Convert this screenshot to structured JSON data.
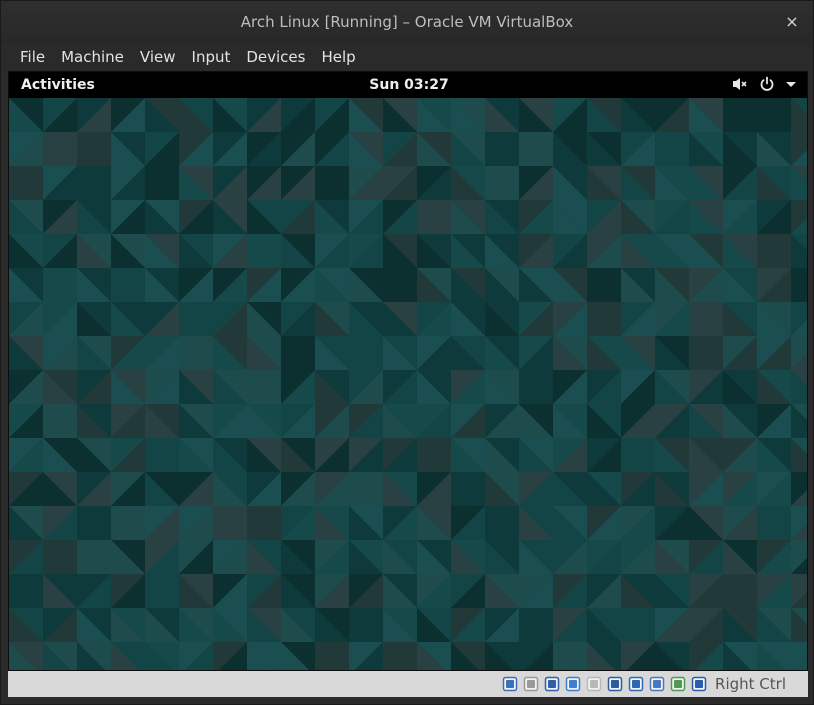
{
  "window": {
    "title": "Arch Linux [Running] – Oracle VM VirtualBox",
    "close_glyph": "×"
  },
  "menubar": {
    "items": [
      {
        "label": "File"
      },
      {
        "label": "Machine"
      },
      {
        "label": "View"
      },
      {
        "label": "Input"
      },
      {
        "label": "Devices"
      },
      {
        "label": "Help"
      }
    ]
  },
  "guest": {
    "topbar": {
      "activities_label": "Activities",
      "clock": "Sun 03:27",
      "status_icons": [
        "volume-muted-icon",
        "power-icon",
        "dropdown-arrow-icon"
      ]
    },
    "wallpaper": {
      "style": "low-poly triangles",
      "colors": [
        "#0f3a3b",
        "#144546",
        "#1a4e50",
        "#0c2f30",
        "#16494a",
        "#22393a",
        "#1e4b4c",
        "#2a4143"
      ]
    }
  },
  "statusbar": {
    "icons": [
      "hard-disk-icon",
      "optical-drive-icon",
      "network-icon",
      "usb-icon",
      "shared-folders-icon",
      "display-icon",
      "video-capture-icon",
      "drag-drop-icon",
      "mouse-integration-icon",
      "keyboard-capture-icon"
    ],
    "host_key": "Right Ctrl"
  },
  "colors": {
    "titlebar_bg": "#2b2b2b",
    "title_text": "#bdbdbd",
    "menu_text": "#e3e3e3",
    "topbar_bg": "#000000",
    "statusbar_bg": "#d9d9d9"
  }
}
